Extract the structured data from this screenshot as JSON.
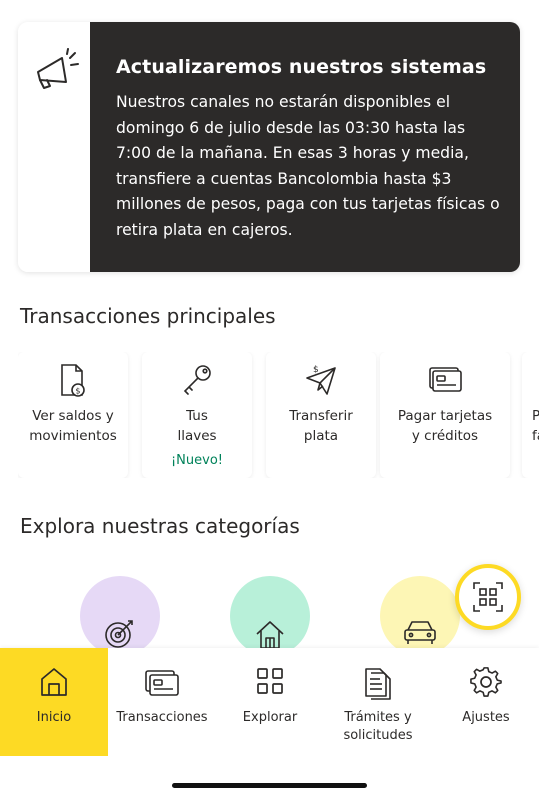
{
  "banner": {
    "icon": "megaphone-icon",
    "title": "Actualizaremos nuestros sistemas",
    "text": "Nuestros canales no estarán disponibles el domingo 6 de julio desde las 03:30 hasta las 7:00 de la mañana. En esas 3 horas y media, transfiere a cuentas Bancolombia hasta $3 millones de pesos, paga con tus tarjetas físicas o retira plata en cajeros."
  },
  "transactions": {
    "title": "Transacciones principales",
    "items": [
      {
        "icon": "balance-document-icon",
        "label_line1": "Ver saldos y",
        "label_line2": "movimientos"
      },
      {
        "icon": "key-icon",
        "label_line1": "Tus",
        "label_line2": "llaves",
        "badge": "¡Nuevo!"
      },
      {
        "icon": "transfer-plane-icon",
        "label_line1": "Transferir",
        "label_line2": "plata"
      },
      {
        "icon": "credit-card-icon",
        "label_line1": "Pagar tarjetas",
        "label_line2": "y créditos"
      },
      {
        "icon": "partial-icon",
        "label_line1": "P",
        "label_line2": "fa"
      }
    ]
  },
  "categories": {
    "title": "Explora nuestras categorías",
    "items": [
      {
        "icon": "target-icon",
        "color": "#e6d9f6"
      },
      {
        "icon": "house-icon",
        "color": "#b8f0d9"
      },
      {
        "icon": "car-icon",
        "color": "#fdf6b5"
      }
    ]
  },
  "qr": {
    "icon": "qr-code-icon",
    "ring_color": "#fdda24"
  },
  "bottom_nav": {
    "items": [
      {
        "icon": "home-icon",
        "label": "Inicio",
        "active": true
      },
      {
        "icon": "transactions-icon",
        "label": "Transacciones"
      },
      {
        "icon": "grid-icon",
        "label": "Explorar"
      },
      {
        "icon": "documents-icon",
        "label_line1": "Trámites y",
        "label_line2": "solicitudes"
      },
      {
        "icon": "gear-icon",
        "label": "Ajustes"
      }
    ]
  },
  "colors": {
    "accent": "#fdda24",
    "dark": "#2c2a29",
    "new_badge": "#00825a"
  }
}
